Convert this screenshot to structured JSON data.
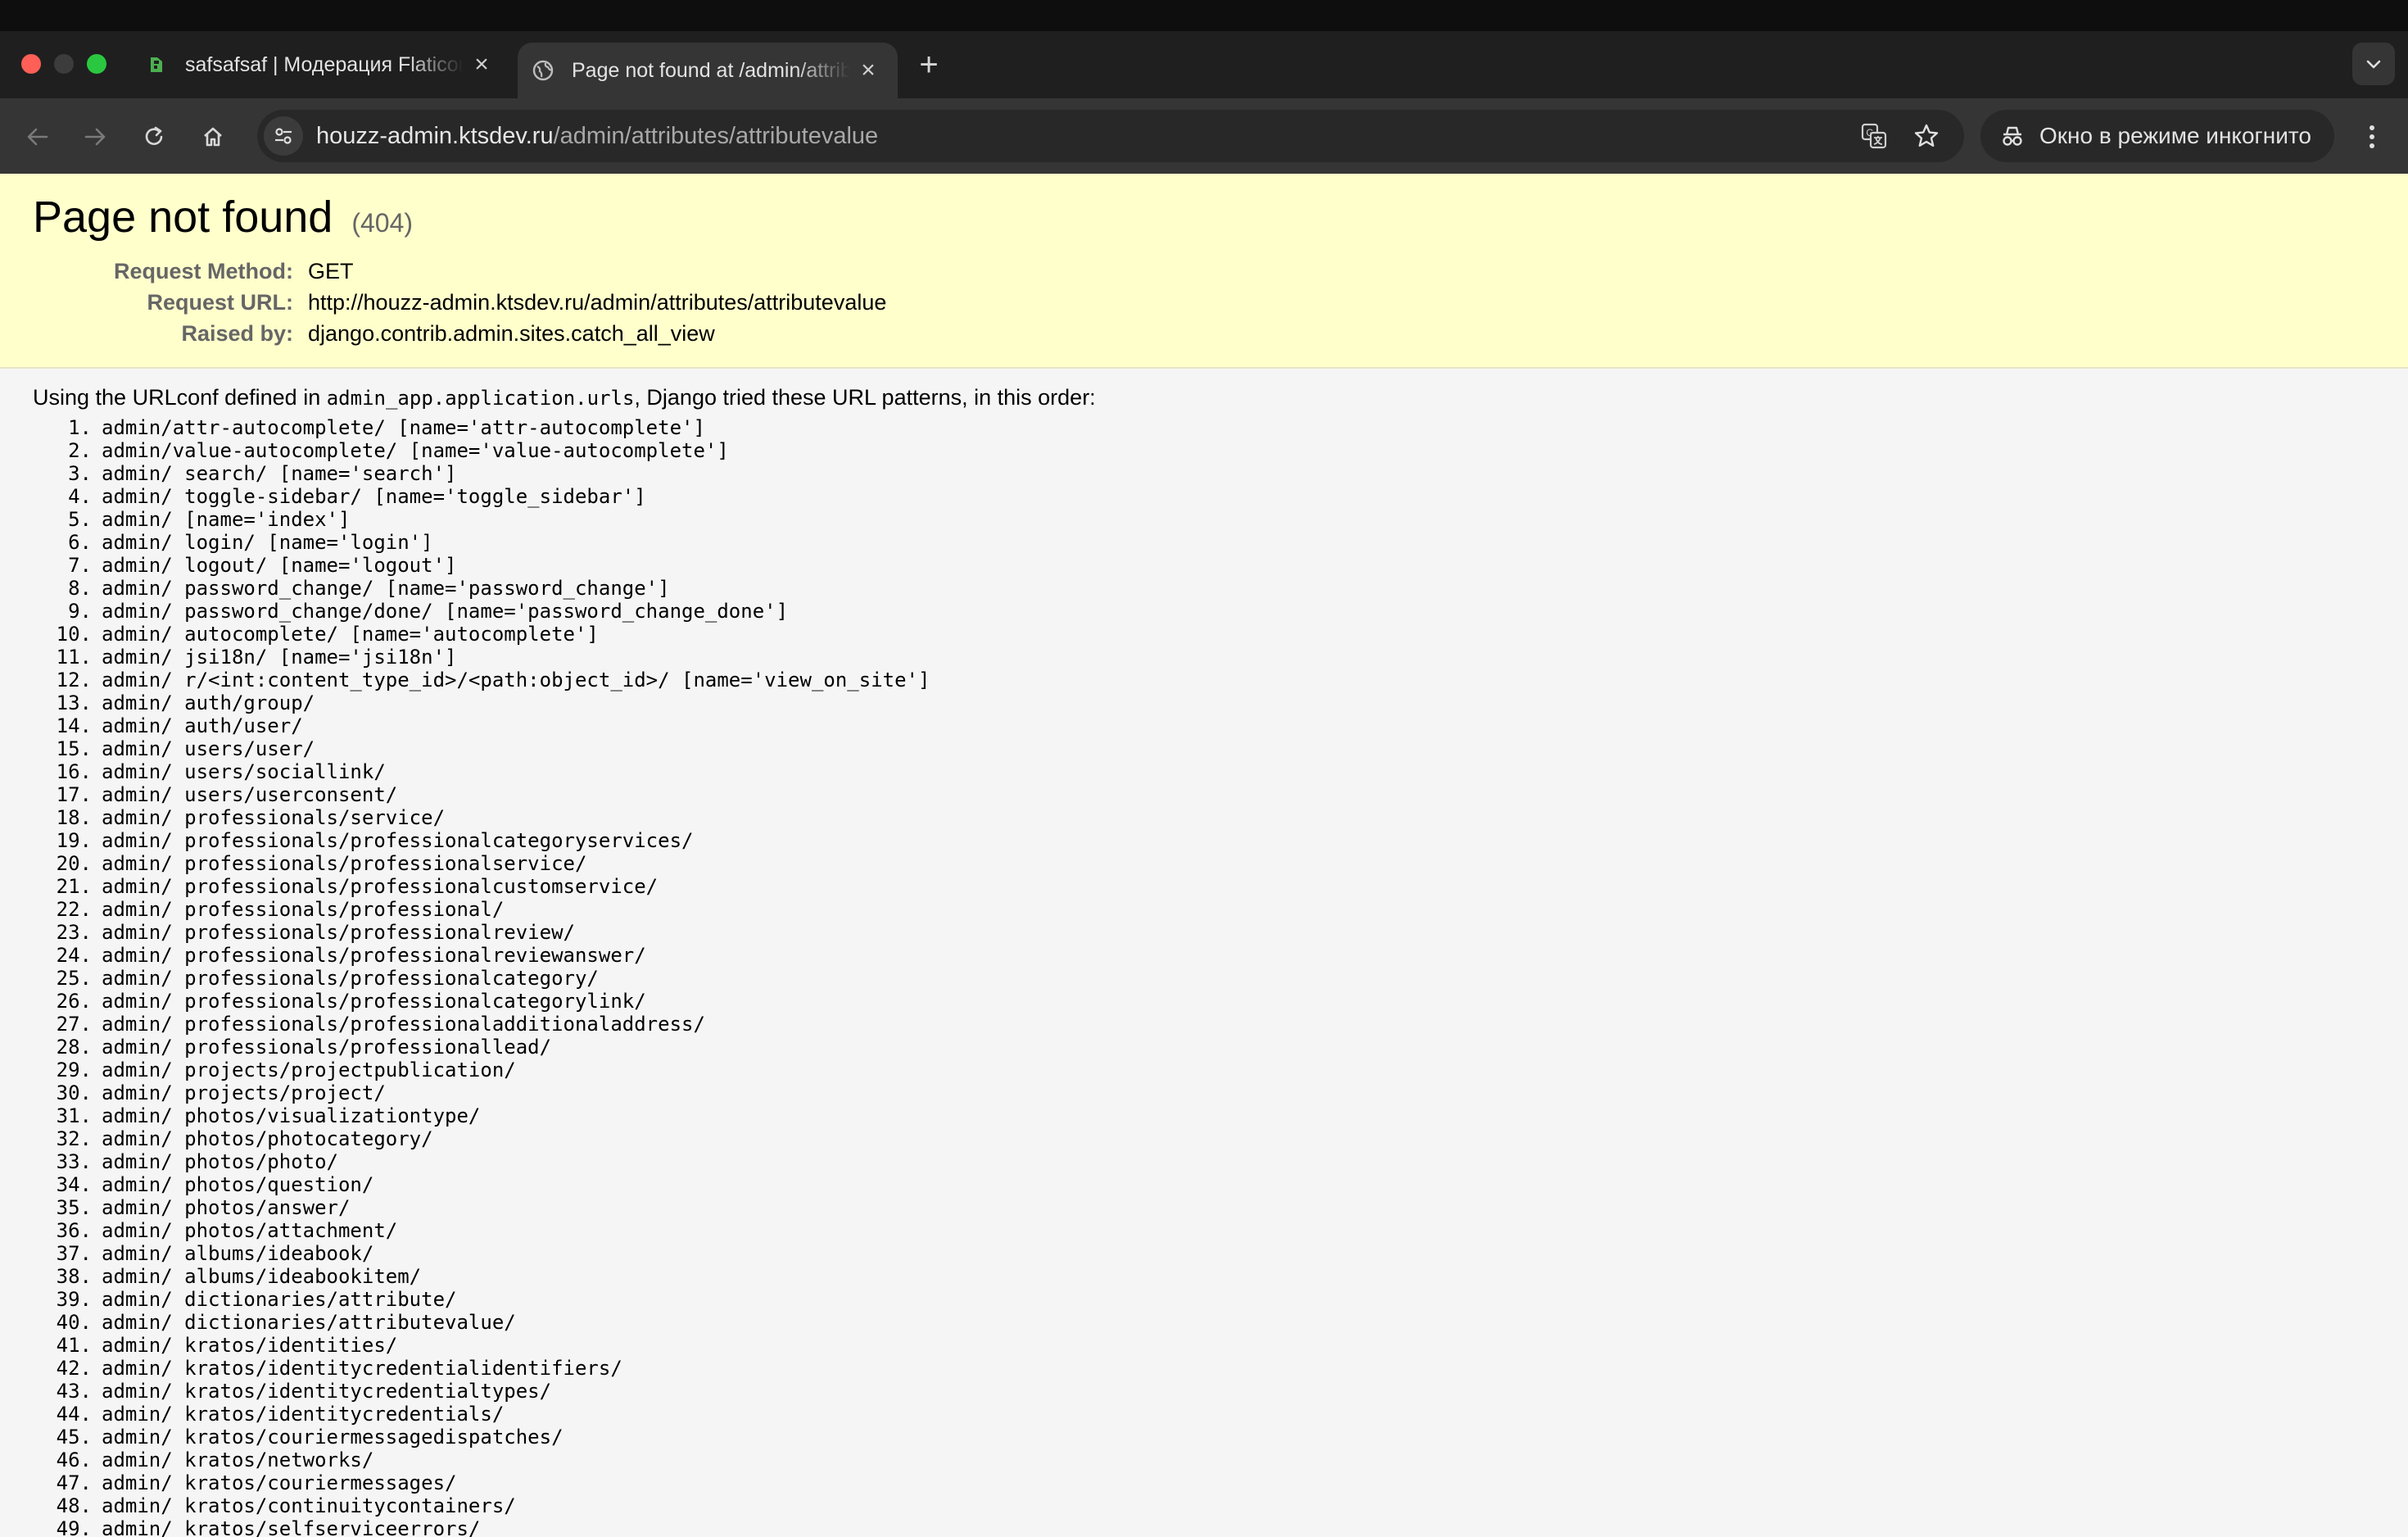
{
  "browser": {
    "tabs": [
      {
        "title": "safsafsaf | Модерация Flaticon",
        "active": false
      },
      {
        "title": "Page not found at /admin/attributes/attributevalue",
        "active": true
      }
    ],
    "address_bar": {
      "host": "houzz-admin.ktsdev.ru",
      "path": "/admin/attributes/attributevalue"
    },
    "incognito_label": "Окно в режиме инкогнито"
  },
  "error": {
    "title": "Page not found",
    "code": "(404)",
    "fields": [
      {
        "label": "Request Method:",
        "value": "GET"
      },
      {
        "label": "Request URL:",
        "value": "http://houzz-admin.ktsdev.ru/admin/attributes/attributevalue"
      },
      {
        "label": "Raised by:",
        "value": "django.contrib.admin.sites.catch_all_view"
      }
    ],
    "intro_before": "Using the URLconf defined in ",
    "intro_code": "admin_app.application.urls",
    "intro_after": ", Django tried these URL patterns, in this order:",
    "patterns": [
      "admin/attr-autocomplete/ [name='attr-autocomplete']",
      "admin/value-autocomplete/ [name='value-autocomplete']",
      "admin/ search/ [name='search']",
      "admin/ toggle-sidebar/ [name='toggle_sidebar']",
      "admin/ [name='index']",
      "admin/ login/ [name='login']",
      "admin/ logout/ [name='logout']",
      "admin/ password_change/ [name='password_change']",
      "admin/ password_change/done/ [name='password_change_done']",
      "admin/ autocomplete/ [name='autocomplete']",
      "admin/ jsi18n/ [name='jsi18n']",
      "admin/ r/<int:content_type_id>/<path:object_id>/ [name='view_on_site']",
      "admin/ auth/group/",
      "admin/ auth/user/",
      "admin/ users/user/",
      "admin/ users/sociallink/",
      "admin/ users/userconsent/",
      "admin/ professionals/service/",
      "admin/ professionals/professionalcategoryservices/",
      "admin/ professionals/professionalservice/",
      "admin/ professionals/professionalcustomservice/",
      "admin/ professionals/professional/",
      "admin/ professionals/professionalreview/",
      "admin/ professionals/professionalreviewanswer/",
      "admin/ professionals/professionalcategory/",
      "admin/ professionals/professionalcategorylink/",
      "admin/ professionals/professionaladditionaladdress/",
      "admin/ professionals/professionallead/",
      "admin/ projects/projectpublication/",
      "admin/ projects/project/",
      "admin/ photos/visualizationtype/",
      "admin/ photos/photocategory/",
      "admin/ photos/photo/",
      "admin/ photos/question/",
      "admin/ photos/answer/",
      "admin/ photos/attachment/",
      "admin/ albums/ideabook/",
      "admin/ albums/ideabookitem/",
      "admin/ dictionaries/attribute/",
      "admin/ dictionaries/attributevalue/",
      "admin/ kratos/identities/",
      "admin/ kratos/identitycredentialidentifiers/",
      "admin/ kratos/identitycredentialtypes/",
      "admin/ kratos/identitycredentials/",
      "admin/ kratos/couriermessagedispatches/",
      "admin/ kratos/networks/",
      "admin/ kratos/couriermessages/",
      "admin/ kratos/continuitycontainers/",
      "admin/ kratos/selfserviceerrors/"
    ]
  }
}
